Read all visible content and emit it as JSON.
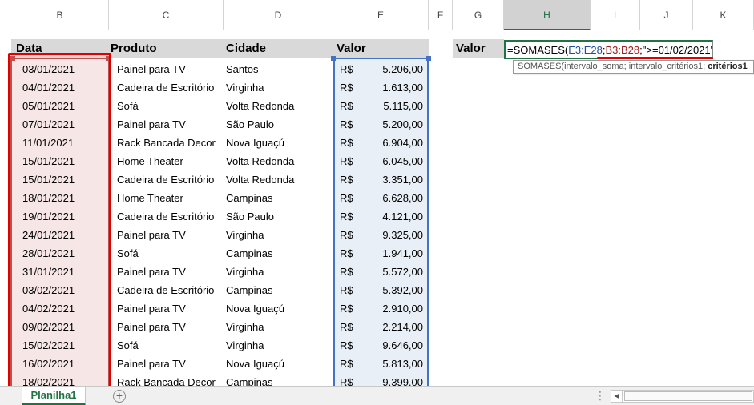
{
  "columns": [
    "B",
    "C",
    "D",
    "E",
    "F",
    "G",
    "H",
    "I",
    "J",
    "K"
  ],
  "active_column": "H",
  "headers": {
    "data": "Data",
    "produto": "Produto",
    "cidade": "Cidade",
    "valor": "Valor"
  },
  "currency": "R$",
  "rows": [
    {
      "data": "03/01/2021",
      "produto": "Painel para TV",
      "cidade": "Santos",
      "valor": "5.206,00"
    },
    {
      "data": "04/01/2021",
      "produto": "Cadeira de Escritório",
      "cidade": "Virginha",
      "valor": "1.613,00"
    },
    {
      "data": "05/01/2021",
      "produto": "Sofá",
      "cidade": "Volta Redonda",
      "valor": "5.115,00"
    },
    {
      "data": "07/01/2021",
      "produto": "Painel para TV",
      "cidade": "São Paulo",
      "valor": "5.200,00"
    },
    {
      "data": "11/01/2021",
      "produto": "Rack Bancada Decor",
      "cidade": "Nova Iguaçú",
      "valor": "6.904,00"
    },
    {
      "data": "15/01/2021",
      "produto": "Home Theater",
      "cidade": "Volta Redonda",
      "valor": "6.045,00"
    },
    {
      "data": "15/01/2021",
      "produto": "Cadeira de Escritório",
      "cidade": "Volta Redonda",
      "valor": "3.351,00"
    },
    {
      "data": "18/01/2021",
      "produto": "Home Theater",
      "cidade": "Campinas",
      "valor": "6.628,00"
    },
    {
      "data": "19/01/2021",
      "produto": "Cadeira de Escritório",
      "cidade": "São Paulo",
      "valor": "4.121,00"
    },
    {
      "data": "24/01/2021",
      "produto": "Painel para TV",
      "cidade": "Virginha",
      "valor": "9.325,00"
    },
    {
      "data": "28/01/2021",
      "produto": "Sofá",
      "cidade": "Campinas",
      "valor": "1.941,00"
    },
    {
      "data": "31/01/2021",
      "produto": "Painel para TV",
      "cidade": "Virginha",
      "valor": "5.572,00"
    },
    {
      "data": "03/02/2021",
      "produto": "Cadeira de Escritório",
      "cidade": "Campinas",
      "valor": "5.392,00"
    },
    {
      "data": "04/02/2021",
      "produto": "Painel para TV",
      "cidade": "Nova Iguaçú",
      "valor": "2.910,00"
    },
    {
      "data": "09/02/2021",
      "produto": "Painel para TV",
      "cidade": "Virginha",
      "valor": "2.214,00"
    },
    {
      "data": "15/02/2021",
      "produto": "Sofá",
      "cidade": "Virginha",
      "valor": "9.646,00"
    },
    {
      "data": "16/02/2021",
      "produto": "Painel para TV",
      "cidade": "Nova Iguaçú",
      "valor": "5.813,00"
    },
    {
      "data": "18/02/2021",
      "produto": "Rack Bancada Decor",
      "cidade": "Campinas",
      "valor": "9.399,00"
    }
  ],
  "result_label": "Valor",
  "formula": {
    "prefix": "=SOMASES(",
    "ref1": "E3:E28",
    "sep1": ";",
    "ref2": "B3:B28",
    "suffix": ";\">=01/02/2021\""
  },
  "tooltip": {
    "text": "SOMASES(intervalo_soma; intervalo_critérios1; ",
    "bold": "critérios1"
  },
  "sheet_tab": "Planilha1",
  "add_sheet_symbol": "+",
  "scroll_left_symbol": "◀",
  "dots_symbol": "⋮"
}
